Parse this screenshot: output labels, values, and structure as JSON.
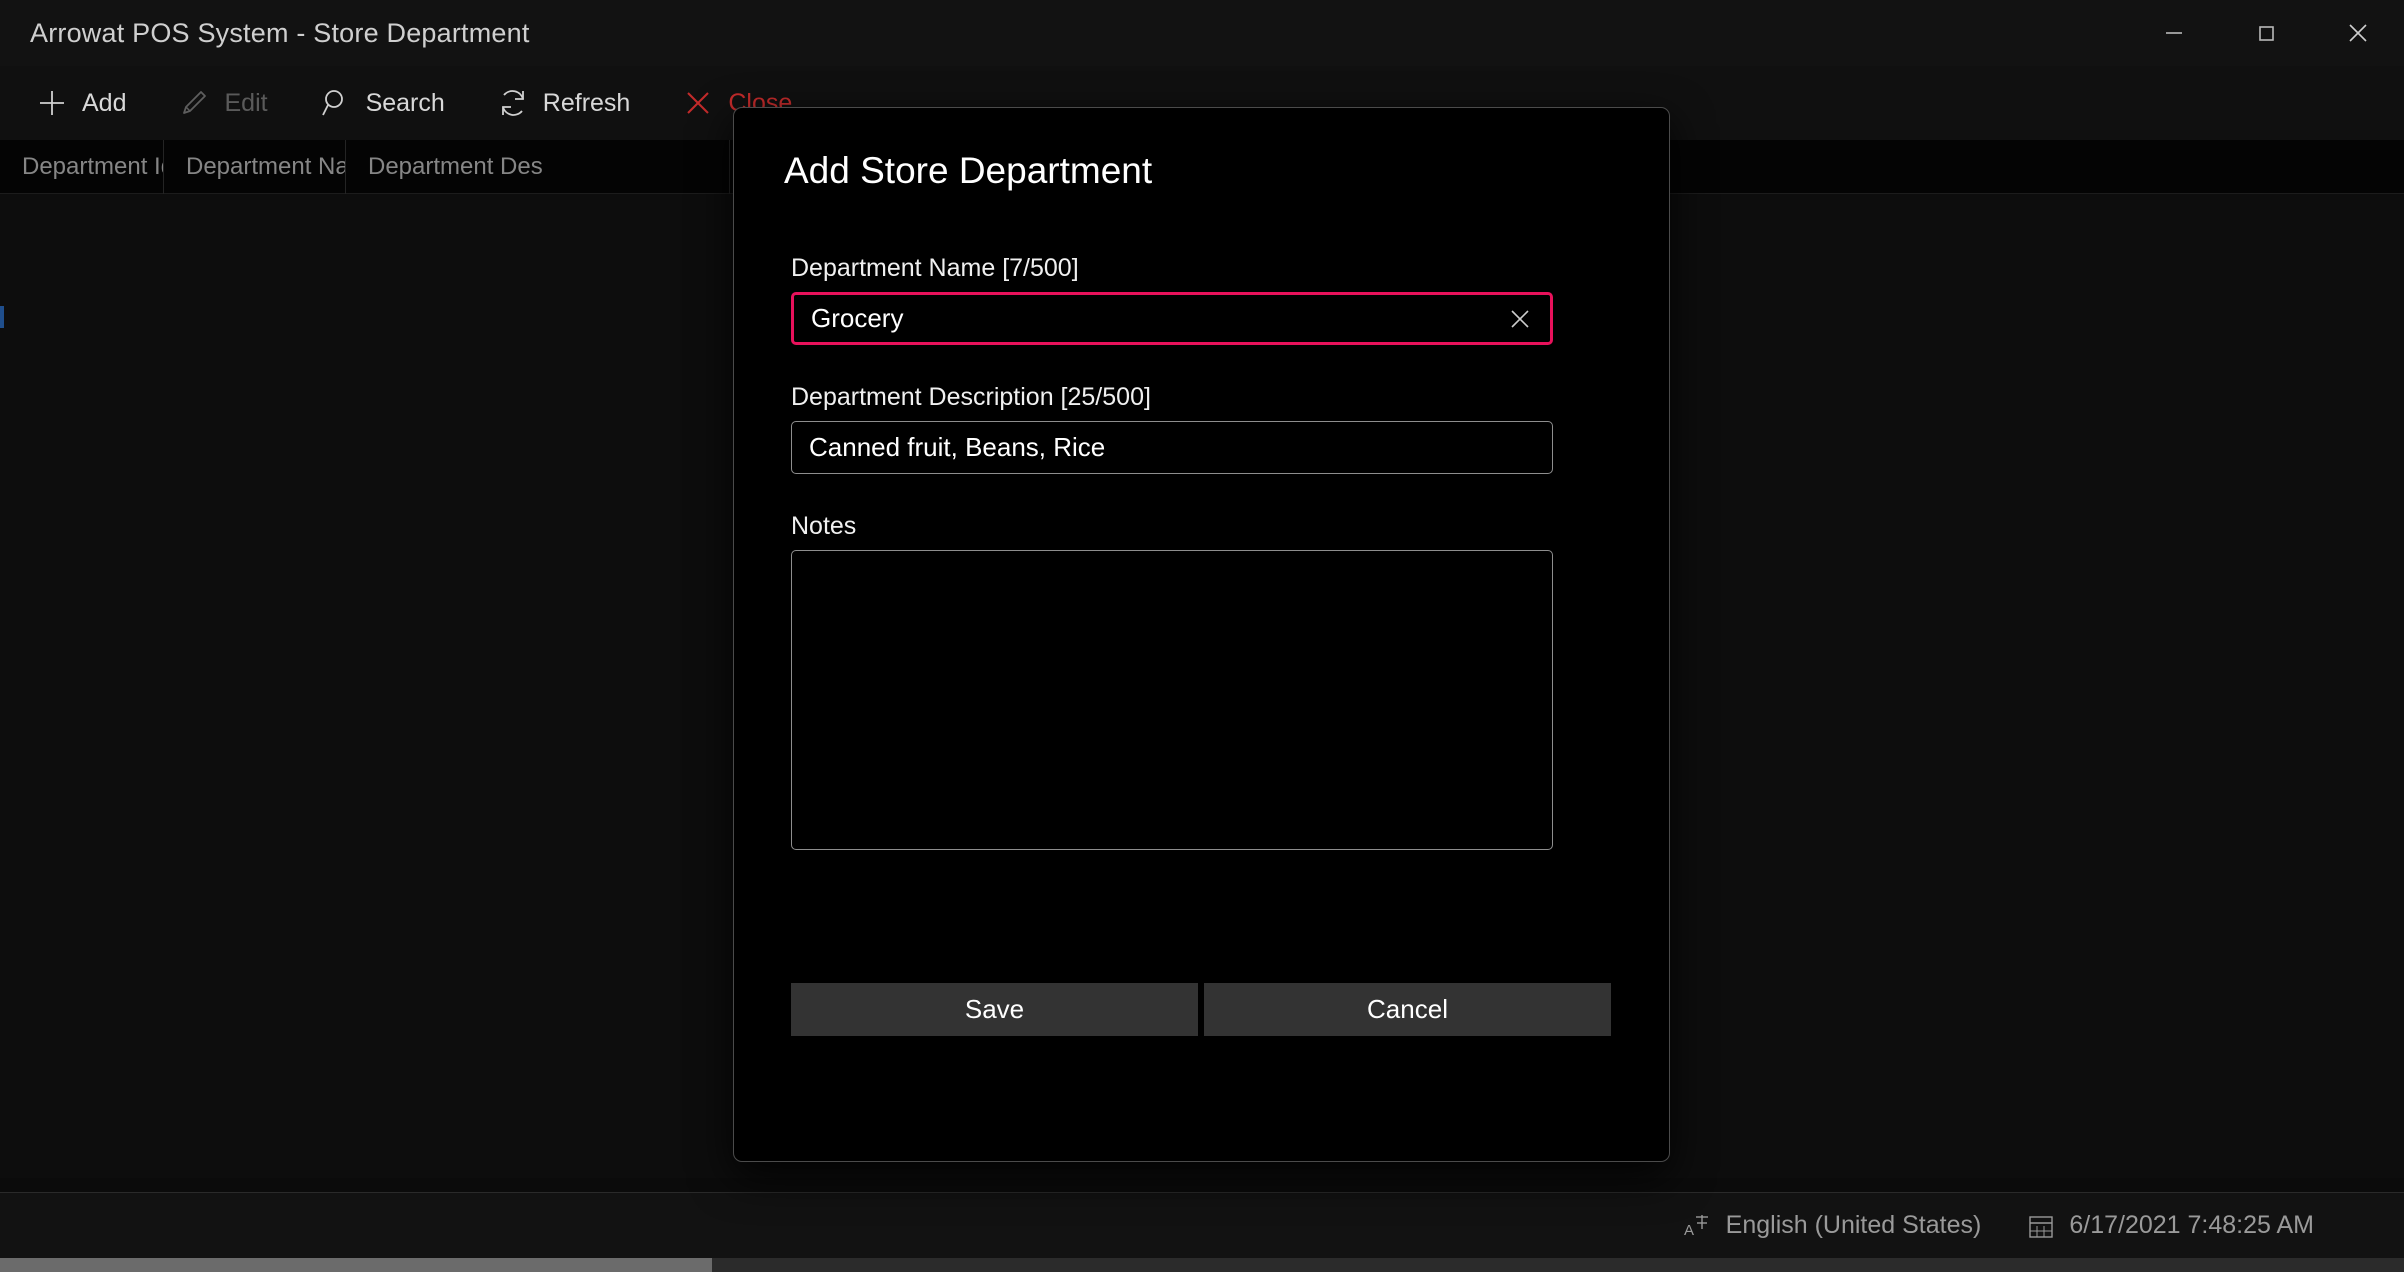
{
  "window": {
    "title": "Arrowat POS System - Store Department",
    "controls": [
      {
        "name": "minimize",
        "glyph": "minimize-icon"
      },
      {
        "name": "maximize",
        "glyph": "maximize-icon"
      },
      {
        "name": "close",
        "glyph": "close-icon"
      }
    ]
  },
  "toolbar": {
    "items": [
      {
        "label": "Add",
        "icon": "plus-icon",
        "state": "enabled"
      },
      {
        "label": "Edit",
        "icon": "pencil-icon",
        "state": "disabled"
      },
      {
        "label": "Search",
        "icon": "magnifier-icon",
        "state": "enabled"
      },
      {
        "label": "Refresh",
        "icon": "refresh-icon",
        "state": "enabled"
      },
      {
        "label": "Close",
        "icon": "x-icon",
        "state": "danger"
      }
    ]
  },
  "grid": {
    "columns": [
      "Department Id",
      "Department Name",
      "Department Des",
      ""
    ],
    "rows": []
  },
  "dialog": {
    "title": "Add Store Department",
    "fields": {
      "name": {
        "label": "Department Name [7/500]",
        "value": "Grocery",
        "clear_icon": "clear-x-icon",
        "focus_color": "#e8115b"
      },
      "description": {
        "label": "Department Description [25/500]",
        "value": "Canned fruit, Beans, Rice"
      },
      "notes": {
        "label": "Notes",
        "value": ""
      }
    },
    "buttons": {
      "save": "Save",
      "cancel": "Cancel"
    }
  },
  "statusbar": {
    "language_icon": "language-icon",
    "language": "English (United States)",
    "calendar_icon": "calendar-icon",
    "datetime": "6/17/2021 7:48:25 AM"
  },
  "colors": {
    "accent_pink": "#e8115b",
    "danger_red": "#c42b2b",
    "row_marker_blue": "#1f4e8c",
    "window_bg": "#0b0b0b",
    "dialog_bg": "#000000"
  }
}
